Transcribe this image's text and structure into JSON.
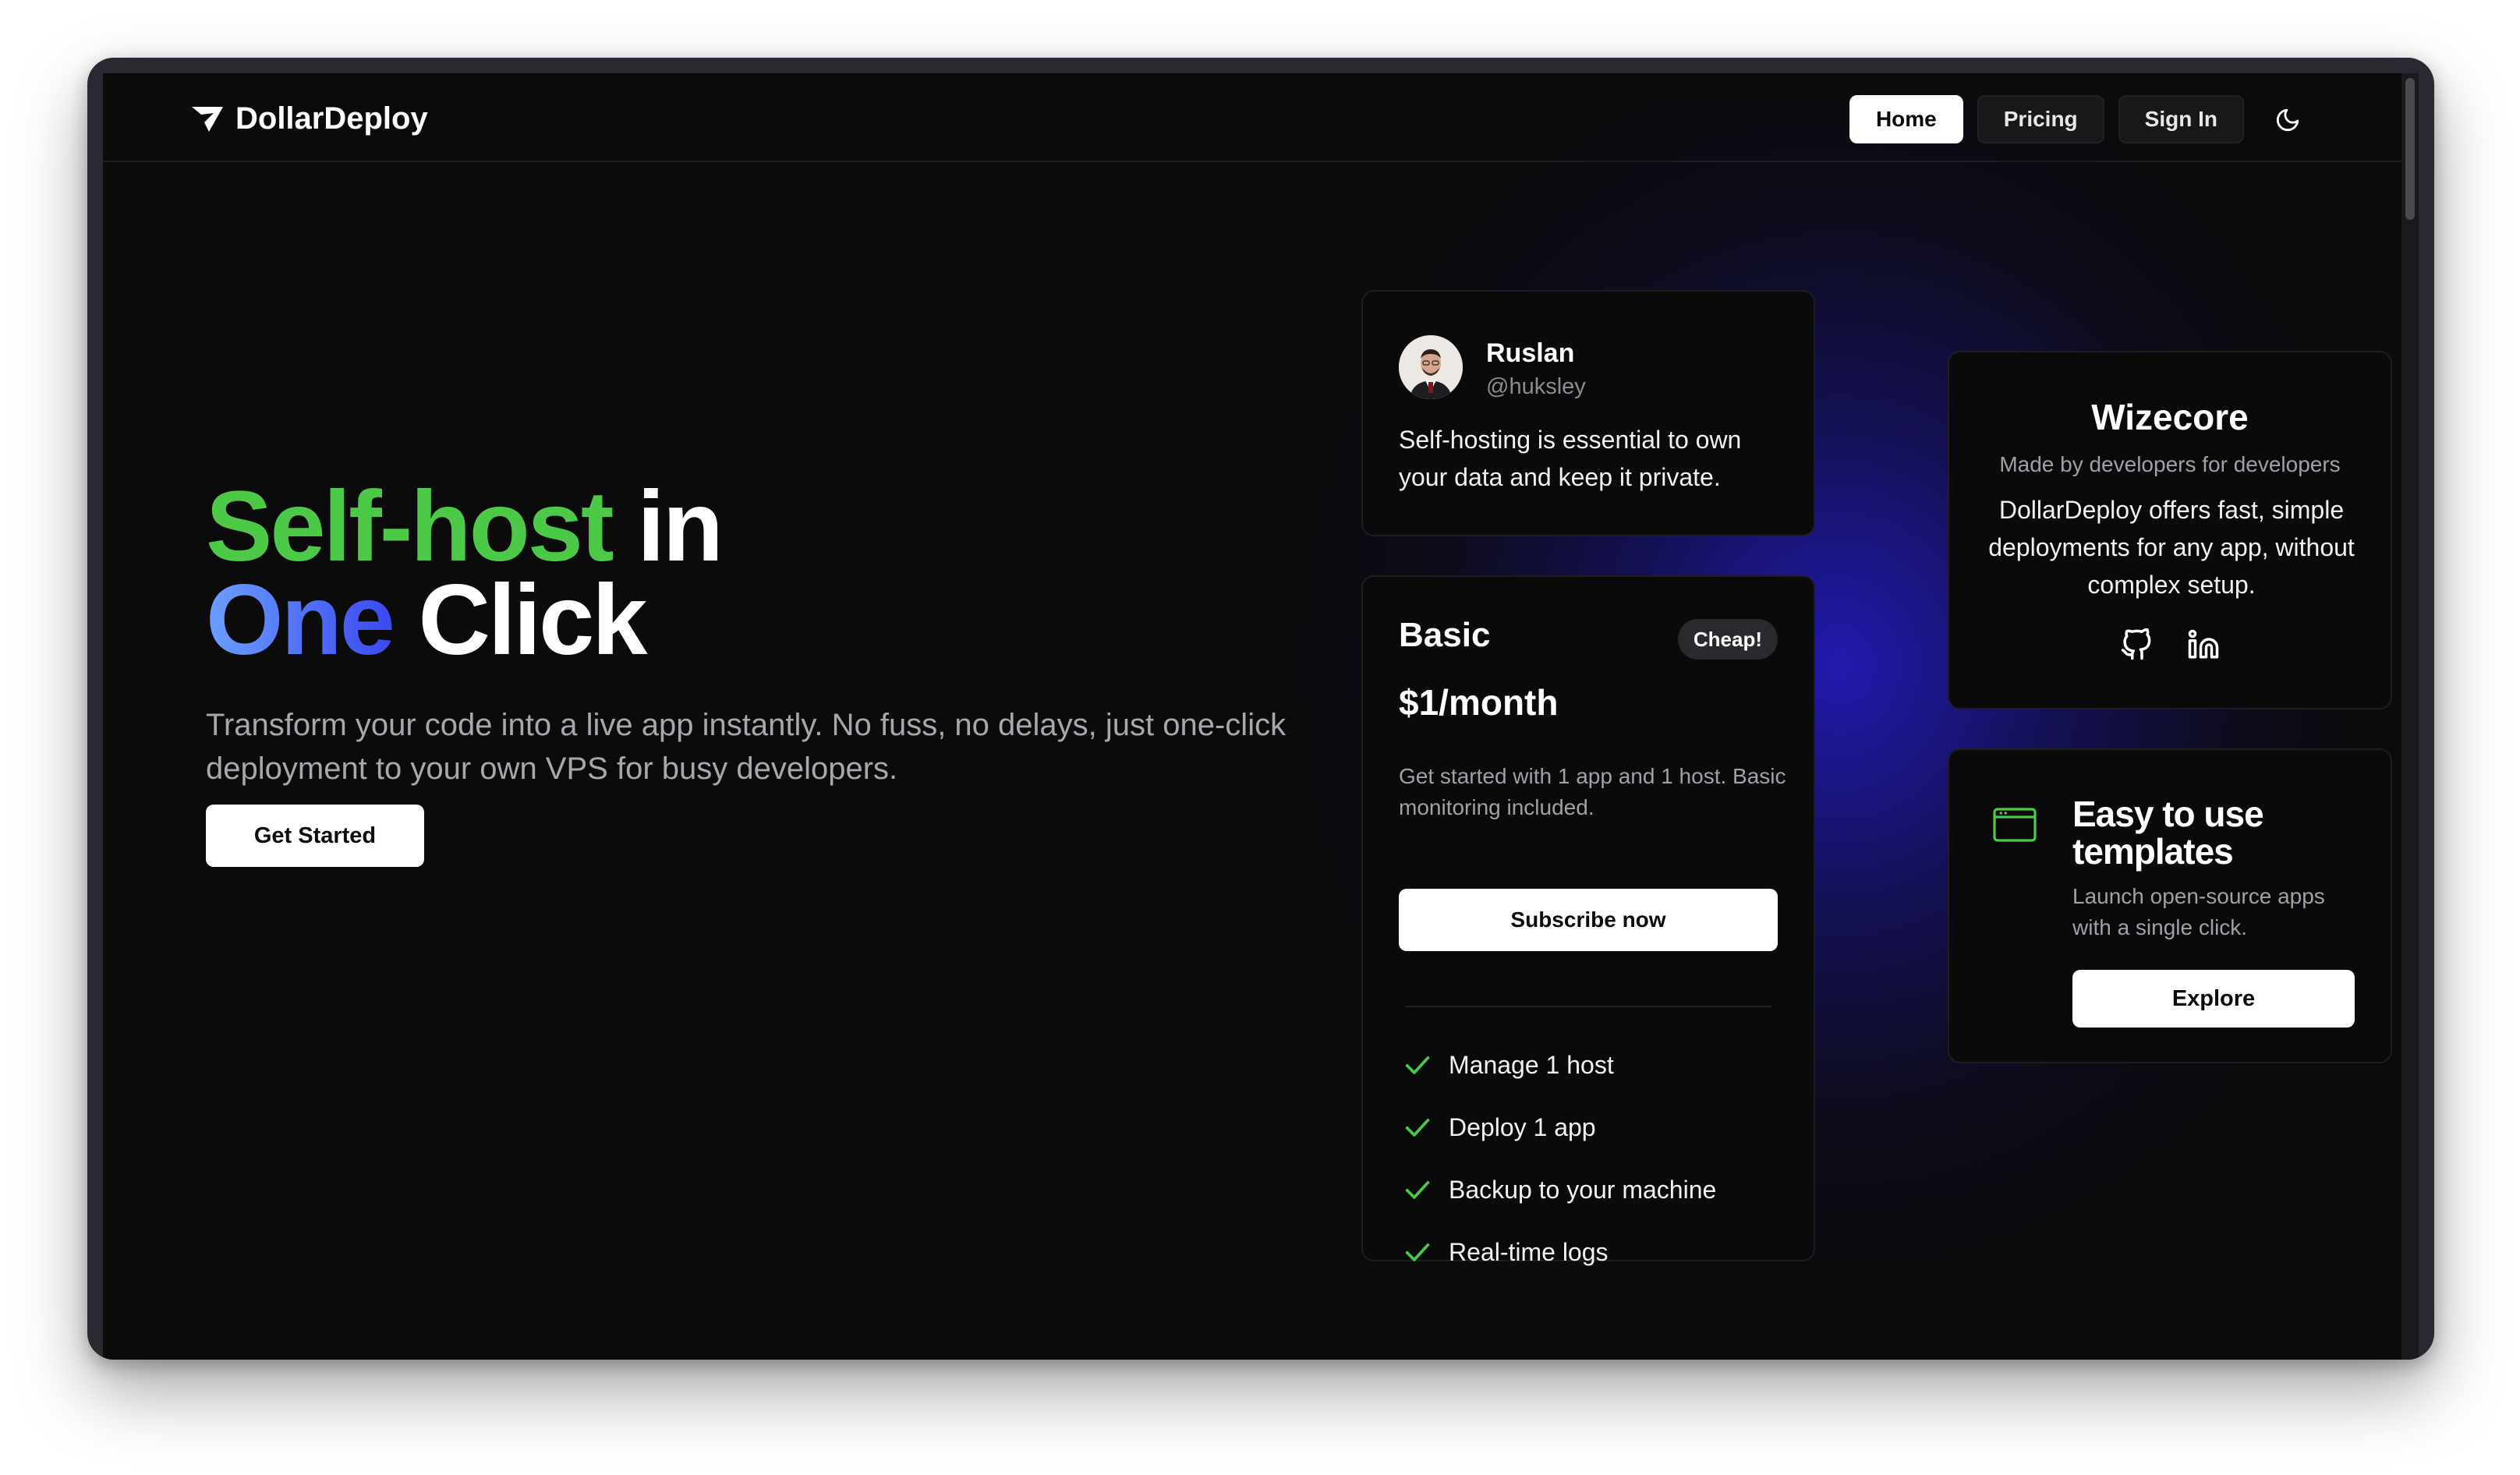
{
  "brand": {
    "name": "DollarDeploy",
    "logo_icon": "dollardeploy-logo-icon"
  },
  "nav": {
    "items": [
      {
        "label": "Home",
        "active": true
      },
      {
        "label": "Pricing",
        "active": false
      },
      {
        "label": "Sign In",
        "active": false
      }
    ],
    "theme_toggle_icon": "moon-icon"
  },
  "hero": {
    "title_part1": "Self-host",
    "title_part2": " in",
    "title_part3": "One",
    "title_part4": " Click",
    "subtitle": "Transform your code into a live app instantly. No fuss, no delays, just one-click deployment to your own VPS for busy developers.",
    "cta_label": "Get Started"
  },
  "testimonial": {
    "name": "Ruslan",
    "handle": "@huksley",
    "quote": "Self-hosting is essential to own your data and keep it private."
  },
  "pricing": {
    "plan": "Basic",
    "badge": "Cheap!",
    "price": "$1/month",
    "description": "Get started with 1 app and 1 host. Basic monitoring included.",
    "button_label": "Subscribe now",
    "features": [
      "Manage 1 host",
      "Deploy 1 app",
      "Backup to your machine",
      "Real-time logs"
    ]
  },
  "wizecore": {
    "title": "Wizecore",
    "tagline": "Made by developers for developers",
    "description": "DollarDeploy offers fast, simple deployments for any app, without complex setup.",
    "icons": [
      "github-icon",
      "linkedin-icon"
    ]
  },
  "templates": {
    "title": "Easy to use templates",
    "description": "Launch open-source apps with a single click.",
    "button_label": "Explore",
    "icon": "browser-window-icon"
  },
  "colors": {
    "accent_green": "#4cc947",
    "accent_blue": "#3b48f0",
    "background": "#0b0b0c"
  }
}
